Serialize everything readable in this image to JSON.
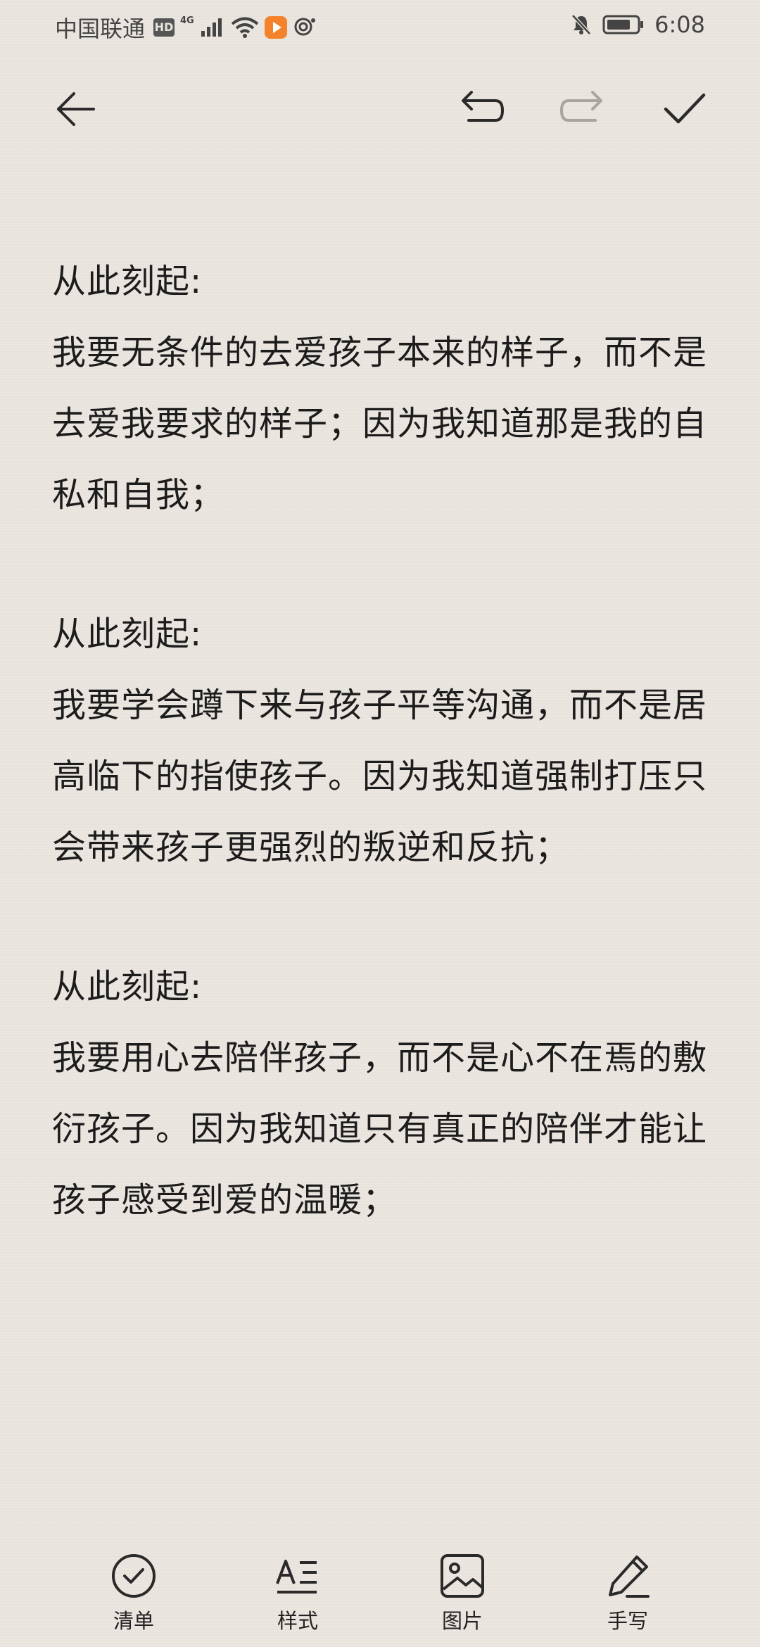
{
  "status_bar": {
    "carrier": "中国联通",
    "hd": "HD",
    "network": "4G",
    "time": "6:08",
    "icons": [
      "hd-icon",
      "signal-icon",
      "wifi-icon",
      "video-app-icon",
      "hotspot-icon",
      "mute-icon",
      "battery-icon"
    ]
  },
  "toolbar": {
    "icons": [
      "back-arrow-icon",
      "undo-icon",
      "redo-icon",
      "check-icon"
    ],
    "redo_enabled": false
  },
  "note": {
    "paragraphs": [
      {
        "heading": "从此刻起:",
        "text": "我要无条件的去爱孩子本来的样子，而不是去爱我要求的样子；因为我知道那是我的自私和自我；"
      },
      {
        "heading": "从此刻起:",
        "text": "我要学会蹲下来与孩子平等沟通，而不是居高临下的指使孩子。因为我知道强制打压只会带来孩子更强烈的叛逆和反抗；"
      },
      {
        "heading": "从此刻起:",
        "text": "我要用心去陪伴孩子，而不是心不在焉的敷衍孩子。因为我知道只有真正的陪伴才能让孩子感受到爱的温暖；"
      }
    ]
  },
  "bottom_bar": {
    "items": [
      {
        "label": "清单",
        "icon": "checklist-icon"
      },
      {
        "label": "样式",
        "icon": "text-style-icon"
      },
      {
        "label": "图片",
        "icon": "image-icon"
      },
      {
        "label": "手写",
        "icon": "handwriting-pen-icon"
      }
    ]
  },
  "colors": {
    "background": "#ebe5df",
    "text": "#1c1c1c",
    "icon": "#2a2a2a",
    "disabled_icon": "#a9a49f"
  }
}
